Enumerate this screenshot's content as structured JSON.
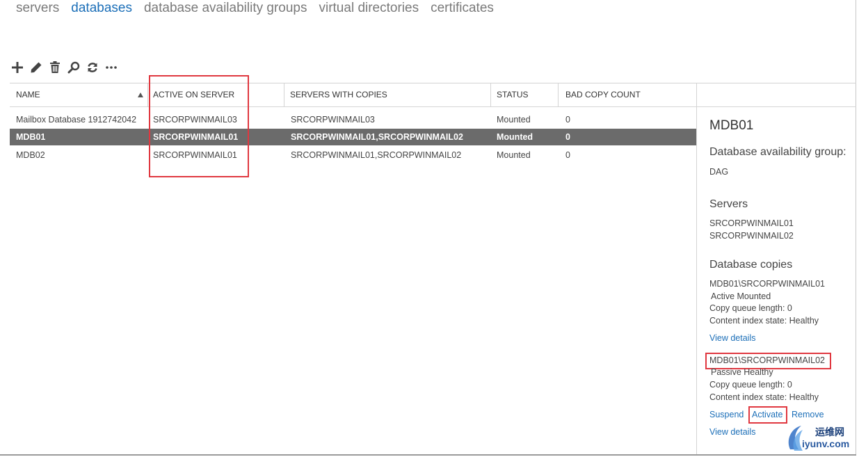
{
  "nav": {
    "tabs": [
      {
        "label": "servers",
        "active": false
      },
      {
        "label": "databases",
        "active": true
      },
      {
        "label": "database availability groups",
        "active": false
      },
      {
        "label": "virtual directories",
        "active": false
      },
      {
        "label": "certificates",
        "active": false
      }
    ]
  },
  "toolbar": {
    "icons": [
      "add-icon",
      "edit-icon",
      "delete-icon",
      "search-icon",
      "refresh-icon",
      "more-icon"
    ]
  },
  "grid": {
    "columns": [
      "NAME",
      "ACTIVE ON SERVER",
      "SERVERS WITH COPIES",
      "STATUS",
      "BAD COPY COUNT"
    ],
    "sort": {
      "column": "NAME",
      "direction": "ascending"
    },
    "rows": [
      {
        "name": "Mailbox Database 1912742042",
        "active_on_server": "SRCORPWINMAIL03",
        "servers_with_copies": "SRCORPWINMAIL03",
        "status": "Mounted",
        "bad_copy_count": "0",
        "selected": false
      },
      {
        "name": "MDB01",
        "active_on_server": "SRCORPWINMAIL01",
        "servers_with_copies": "SRCORPWINMAIL01,SRCORPWINMAIL02",
        "status": "Mounted",
        "bad_copy_count": "0",
        "selected": true
      },
      {
        "name": "MDB02",
        "active_on_server": "SRCORPWINMAIL01",
        "servers_with_copies": "SRCORPWINMAIL01,SRCORPWINMAIL02",
        "status": "Mounted",
        "bad_copy_count": "0",
        "selected": false
      }
    ]
  },
  "details": {
    "title": "MDB01",
    "dag_heading": "Database availability group:",
    "dag_value": "DAG",
    "servers_heading": "Servers",
    "servers": [
      "SRCORPWINMAIL01",
      "SRCORPWINMAIL02"
    ],
    "copies_heading": "Database copies",
    "copies": [
      {
        "name": "MDB01\\SRCORPWINMAIL01",
        "state": "Active Mounted",
        "queue": "Copy queue length: 0",
        "index": "Content index state:  Healthy",
        "links": [
          "View details"
        ]
      },
      {
        "name": "MDB01\\SRCORPWINMAIL02",
        "state": "Passive Healthy",
        "queue": "Copy queue length: 0",
        "index": "Content index state:  Healthy",
        "actions": [
          "Suspend",
          "Activate",
          "Remove"
        ],
        "links": [
          "View details"
        ]
      }
    ]
  },
  "watermark": {
    "line1": "运维网",
    "line2": "iyunv.com"
  },
  "colors": {
    "accent": "#1c6fb8",
    "selected_row": "#6b6b6b",
    "annotation": "#e0373f"
  }
}
